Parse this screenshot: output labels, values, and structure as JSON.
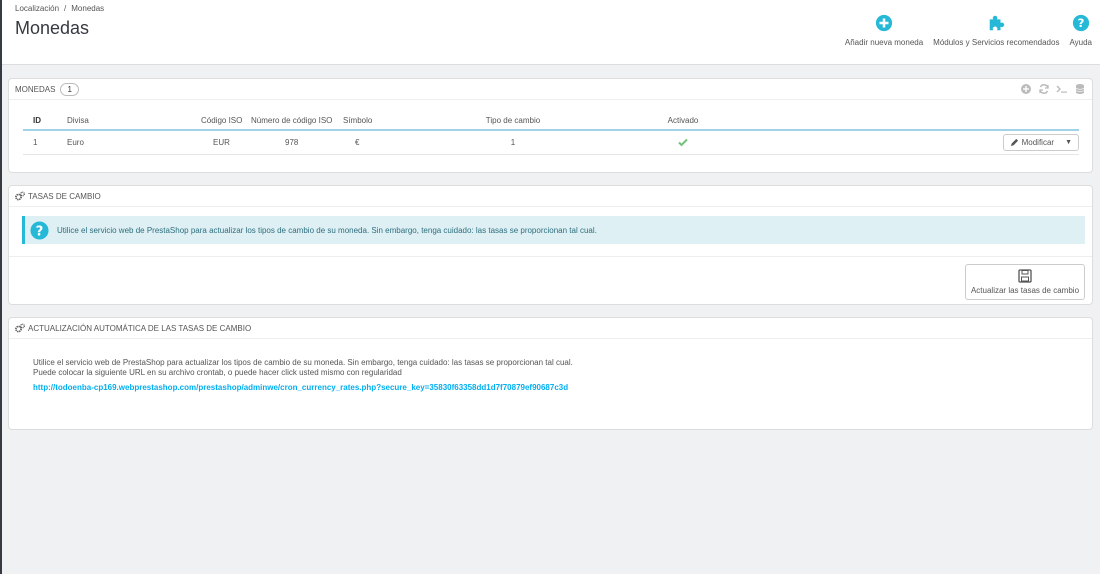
{
  "breadcrumb": {
    "parent": "Localización",
    "separator": "/",
    "current": "Monedas"
  },
  "page_title": "Monedas",
  "toolbar": {
    "add_currency": "Añadir nueva moneda",
    "modules": "Módulos y Servicios recomendados",
    "help": "Ayuda"
  },
  "currencies_panel": {
    "title": "Monedas",
    "count": "1",
    "columns": [
      "ID",
      "Divisa",
      "Código ISO",
      "Número de código ISO",
      "Símbolo",
      "Tipo de cambio",
      "Activado"
    ],
    "rows": [
      {
        "id": "1",
        "name": "Euro",
        "iso": "EUR",
        "iso_num": "978",
        "symbol": "€",
        "rate": "1",
        "active": true
      }
    ],
    "edit_label": "Modificar"
  },
  "rates_panel": {
    "title": "Tasas de cambio",
    "alert": "Utilice el servicio web de PrestaShop para actualizar los tipos de cambio de su moneda. Sin embargo, tenga cuidado: las tasas se proporcionan tal cual.",
    "update_button": "Actualizar las tasas de cambio"
  },
  "auto_panel": {
    "title": "Actualización automática de las tasas de cambio",
    "line1": "Utilice el servicio web de PrestaShop para actualizar los tipos de cambio de su moneda. Sin embargo, tenga cuidado: las tasas se proporcionan tal cual.",
    "line2": "Puede colocar la siguiente URL en su archivo crontab, o puede hacer click usted mismo con regularidad",
    "url": "http://todoenba-cp169.webprestashop.com/prestashop/adminwe/cron_currency_rates.php?secure_key=35830f63358dd1d7f70879ef90687c3d"
  },
  "colors": {
    "accent": "#25b9d7",
    "success": "#72c279",
    "link": "#00aff0"
  }
}
